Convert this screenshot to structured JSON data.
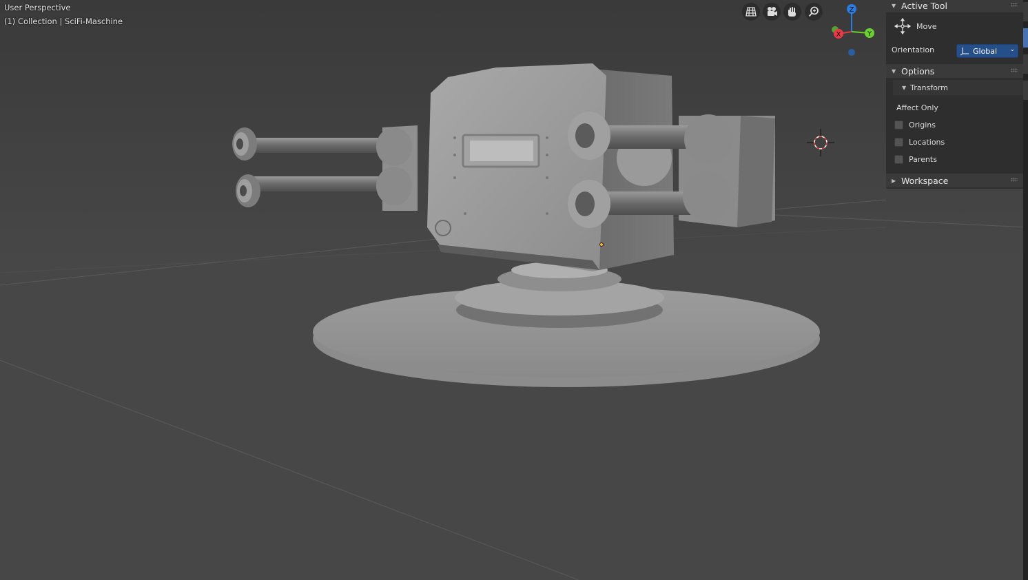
{
  "viewport": {
    "view_name": "User Perspective",
    "collection_info": "(1) Collection | SciFi-Maschine"
  },
  "navigation": {
    "buttons": [
      {
        "name": "toggle-perspective",
        "icon": "grid-icon"
      },
      {
        "name": "camera-view",
        "icon": "camera-icon"
      },
      {
        "name": "pan-view",
        "icon": "hand-icon"
      },
      {
        "name": "zoom-view",
        "icon": "magnifier-icon"
      }
    ]
  },
  "gizmo": {
    "axes": [
      {
        "label": "Z",
        "color": "#2a7de1"
      },
      {
        "label": "Y",
        "color": "#6bd12f"
      },
      {
        "label": "X",
        "color": "#e63a47"
      }
    ]
  },
  "npanel": {
    "active_tool": {
      "title": "Active Tool",
      "tool_name": "Move",
      "orientation_label": "Orientation",
      "orientation_value": "Global"
    },
    "options": {
      "title": "Options",
      "transform_title": "Transform",
      "affect_only_label": "Affect Only",
      "checkboxes": [
        {
          "label": "Origins",
          "checked": false
        },
        {
          "label": "Locations",
          "checked": false
        },
        {
          "label": "Parents",
          "checked": false
        }
      ]
    },
    "workspace": {
      "title": "Workspace"
    }
  },
  "colors": {
    "accent": "#4772b3",
    "select_bg": "#264e89",
    "mesh": "#9a9a9a"
  }
}
